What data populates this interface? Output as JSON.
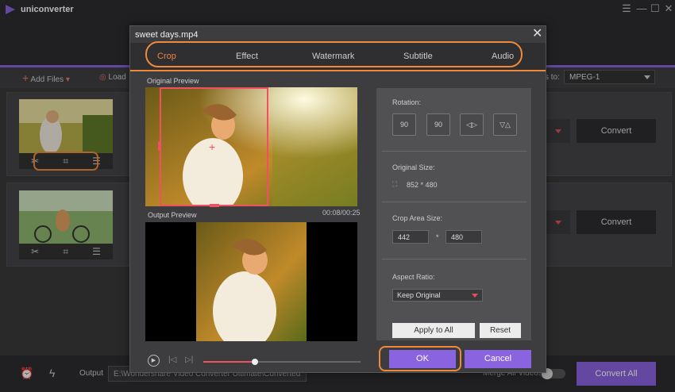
{
  "app": {
    "name": "uniconverter"
  },
  "window_controls": [
    "☰",
    "—",
    "☐",
    "✕"
  ],
  "toolbar": {
    "add_files": "Add Files",
    "load": "Load",
    "format_label": "s to:",
    "format_value": "MPEG-1"
  },
  "rows": [
    {
      "convert_label": "Convert"
    },
    {
      "convert_label": "Convert"
    }
  ],
  "bottom": {
    "output_label": "Output",
    "output_path": "E:\\Wondershare Video Converter Ultimate\\Converted",
    "merge_label": "Merge All Videos",
    "convert_all": "Convert All"
  },
  "dialog": {
    "title": "sweet days.mp4",
    "tabs": [
      "Crop",
      "Effect",
      "Watermark",
      "Subtitle",
      "Audio"
    ],
    "active_tab": "Crop",
    "original_preview_label": "Original Preview",
    "output_preview_label": "Output Preview",
    "timecode": "00:08/00:25",
    "playback_progress": 0.33,
    "rotation_label": "Rotation:",
    "rotation_buttons": [
      "90",
      "90",
      "◁▷",
      "▽△"
    ],
    "original_size_label": "Original Size:",
    "original_size_value": "852 * 480",
    "crop_area_label": "Crop Area Size:",
    "crop_width": "442",
    "crop_sep": "*",
    "crop_height": "480",
    "aspect_label": "Aspect Ratio:",
    "aspect_value": "Keep Original",
    "apply_all": "Apply to All",
    "reset": "Reset",
    "ok": "OK",
    "cancel": "Cancel"
  },
  "colors": {
    "accent": "#8a63e0",
    "highlight": "#f08a3a",
    "crop": "#f05060"
  }
}
